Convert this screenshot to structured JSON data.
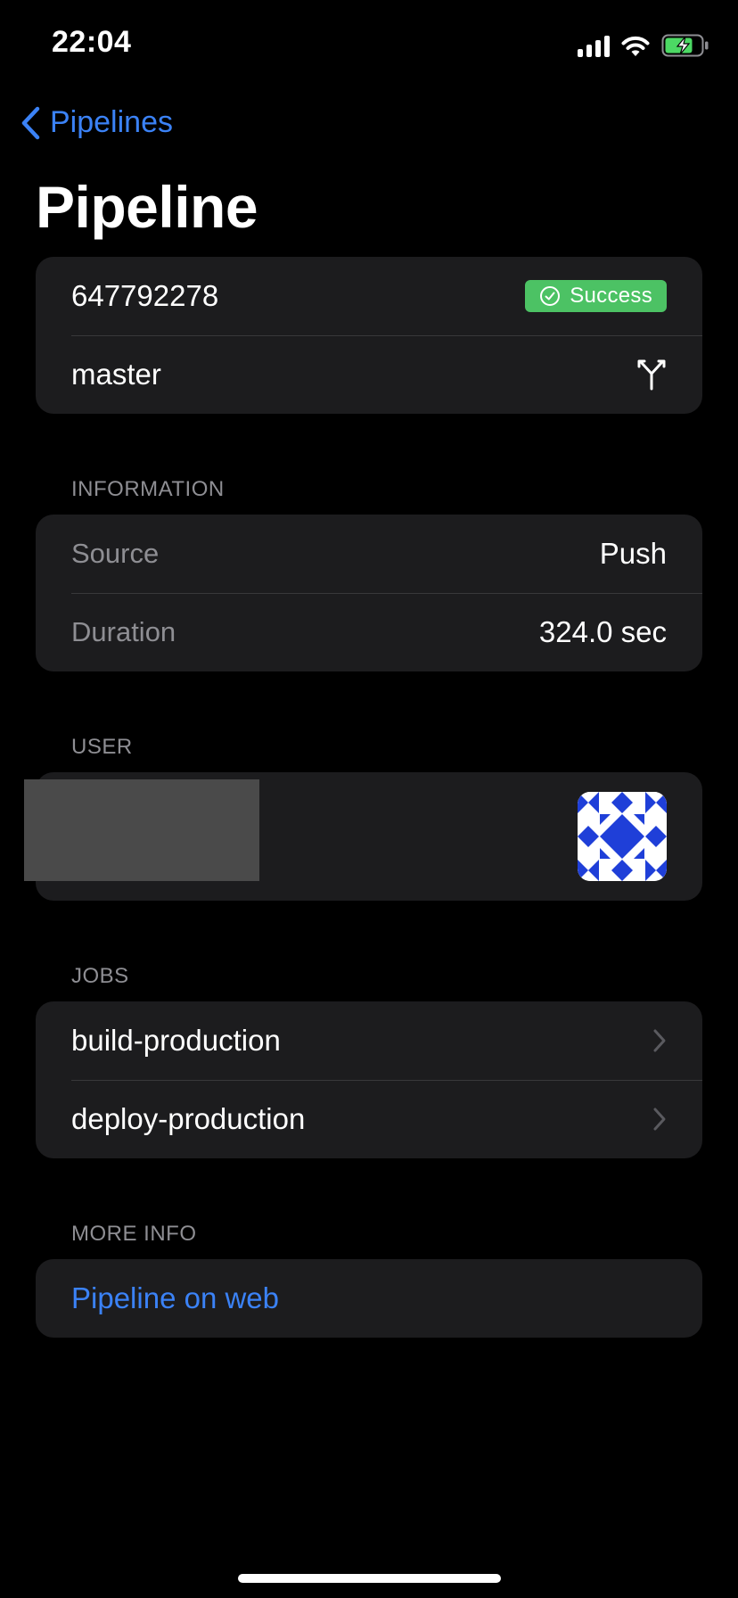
{
  "status_bar": {
    "time": "22:04"
  },
  "nav": {
    "back_label": "Pipelines"
  },
  "page": {
    "title": "Pipeline"
  },
  "summary": {
    "pipeline_id": "647792278",
    "status": "Success",
    "status_color": "#4cc264",
    "branch": "master",
    "branch_icon": "branch-icon"
  },
  "information": {
    "header": "INFORMATION",
    "rows": [
      {
        "label": "Source",
        "value": "Push"
      },
      {
        "label": "Duration",
        "value": "324.0 sec"
      }
    ]
  },
  "user": {
    "header": "USER",
    "avatar_icon": "identicon-avatar"
  },
  "jobs": {
    "header": "JOBS",
    "items": [
      {
        "label": "build-production"
      },
      {
        "label": "deploy-production"
      }
    ]
  },
  "more_info": {
    "header": "MORE INFO",
    "link_label": "Pipeline on web"
  },
  "colors": {
    "accent": "#3b82f6",
    "card_bg": "#1c1c1e",
    "background": "#000000"
  }
}
